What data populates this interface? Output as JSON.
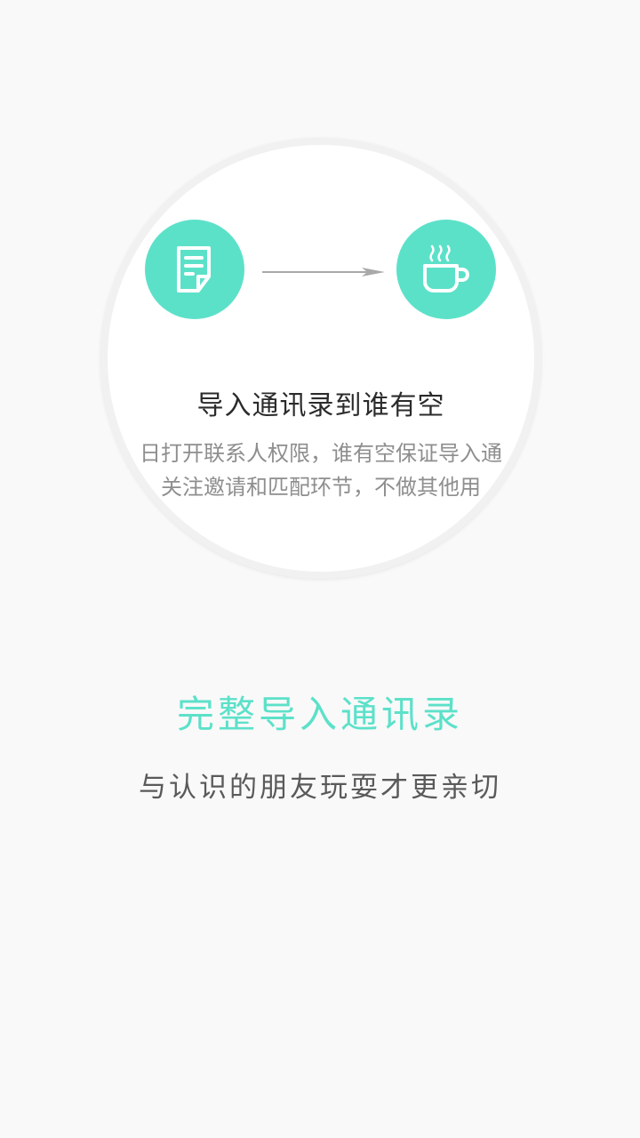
{
  "card": {
    "left_icon": "document-icon",
    "right_icon": "coffee-cup-icon",
    "arrow_icon": "arrow-right-icon",
    "title": "导入通讯录到谁有空",
    "desc_line1": "日打开联系人权限，谁有空保证导入通",
    "desc_line2": "关注邀请和匹配环节，不做其他用"
  },
  "headline": "完整导入通讯录",
  "subline": "与认识的朋友玩耍才更亲切",
  "colors": {
    "accent": "#5ce1c9",
    "background": "#f9f9f9",
    "title": "#2b2b2b",
    "desc": "#8e8e8e",
    "subline": "#5a5a5a"
  }
}
